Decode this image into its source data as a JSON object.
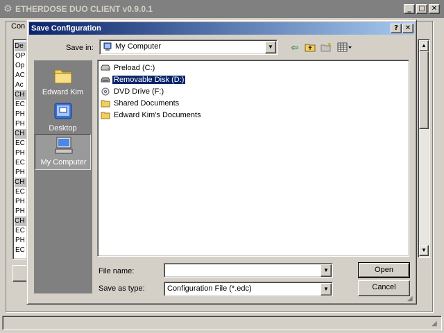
{
  "app": {
    "title": "ETHERDOSE DUO CLIENT v0.9.0.1",
    "group_label": "Con",
    "list_rows": [
      "De",
      "OP",
      "Op",
      "AC",
      "Ac",
      "CH",
      "EC",
      "PH",
      "PH",
      "CH",
      "EC",
      "PH",
      "EC",
      "PH",
      "CH",
      "EC",
      "PH",
      "PH",
      "CH",
      "EC",
      "PH",
      "EC"
    ],
    "caption_buttons": {
      "minimize": "_",
      "maximize": "□",
      "close": "✕"
    }
  },
  "dialog": {
    "title": "Save Configuration",
    "help_button": "?",
    "close_button": "✕",
    "save_in_label": "Save in:",
    "save_in_value": "My Computer",
    "places": [
      {
        "label": "Edward Kim",
        "icon": "folder-icon"
      },
      {
        "label": "Desktop",
        "icon": "desktop-icon"
      },
      {
        "label": "My Computer",
        "icon": "computer-icon",
        "selected": true
      }
    ],
    "files": [
      {
        "label": "Preload (C:)",
        "icon": "hard-drive-icon"
      },
      {
        "label": "Removable Disk (D:)",
        "icon": "removable-disk-icon",
        "selected": true
      },
      {
        "label": "DVD Drive (F:)",
        "icon": "dvd-drive-icon"
      },
      {
        "label": "Shared Documents",
        "icon": "folder-icon"
      },
      {
        "label": "Edward Kim's Documents",
        "icon": "folder-icon"
      }
    ],
    "file_name_label": "File name:",
    "file_name_value": "",
    "save_as_type_label": "Save as type:",
    "save_as_type_value": "Configuration File (*.edc)",
    "open_label": "Open",
    "cancel_label": "Cancel"
  }
}
